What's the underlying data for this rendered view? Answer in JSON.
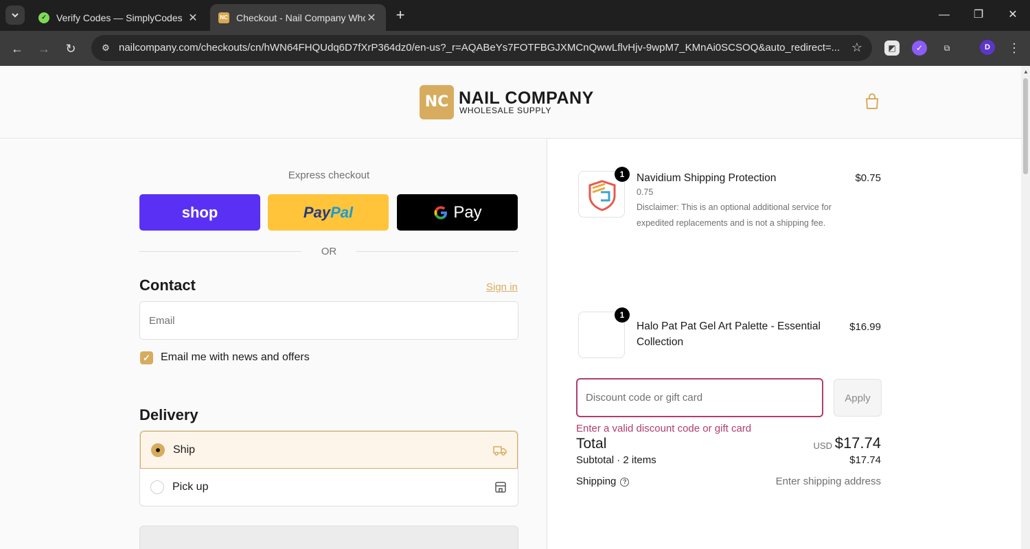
{
  "browser": {
    "tabs": [
      {
        "title": "Verify Codes — SimplyCodes",
        "favicon": "simplycodes-icon",
        "active": false
      },
      {
        "title": "Checkout - Nail Company Whol",
        "favicon": "NC",
        "active": true
      }
    ],
    "url": "nailcompany.com/checkouts/cn/hWN64FHQUdq6D7fXrP364dz0/en-us?_r=AQABeYs7FOTFBGJXMCnQwwLflvHjv-9wpM7_KMnAi0SCSOQ&auto_redirect=...",
    "profile_initial": "D"
  },
  "header": {
    "logo_mark": "NC",
    "logo_name": "NAIL COMPANY",
    "logo_sub": "WHOLESALE SUPPLY"
  },
  "checkout": {
    "express_label": "Express checkout",
    "shop_label": "shop",
    "paypal_label_1": "Pay",
    "paypal_label_2": "Pal",
    "gpay_label": "Pay",
    "or_label": "OR",
    "contact": {
      "title": "Contact",
      "sign_in": "Sign in",
      "email_placeholder": "Email",
      "newsletter_label": "Email me with news and offers",
      "newsletter_checked": true
    },
    "delivery": {
      "title": "Delivery",
      "options": [
        {
          "label": "Ship",
          "selected": true,
          "icon": "truck-icon"
        },
        {
          "label": "Pick up",
          "selected": false,
          "icon": "store-icon"
        }
      ]
    }
  },
  "summary": {
    "items": [
      {
        "name": "Navidium Shipping Protection",
        "quantity": "1",
        "price": "$0.75",
        "variant": "0.75",
        "disclaimer": "Disclaimer: This is an optional additional service for expedited replacements and is not a shipping fee."
      },
      {
        "name": "Halo Pat Pat Gel Art Palette - Essential Collection",
        "quantity": "1",
        "price": "$16.99"
      }
    ],
    "discount_placeholder": "Discount code or gift card",
    "apply_label": "Apply",
    "discount_error": "Enter a valid discount code or gift card",
    "subtotal_label": "Subtotal · 2 items",
    "subtotal_value": "$17.74",
    "shipping_label": "Shipping",
    "shipping_value": "Enter shipping address",
    "total_label": "Total",
    "total_currency": "USD",
    "total_value": "$17.74"
  },
  "colors": {
    "brand_gold": "#d7ac5e",
    "shop_purple": "#5a31f4",
    "paypal_yellow": "#ffc43a",
    "error": "#b03c6e"
  }
}
